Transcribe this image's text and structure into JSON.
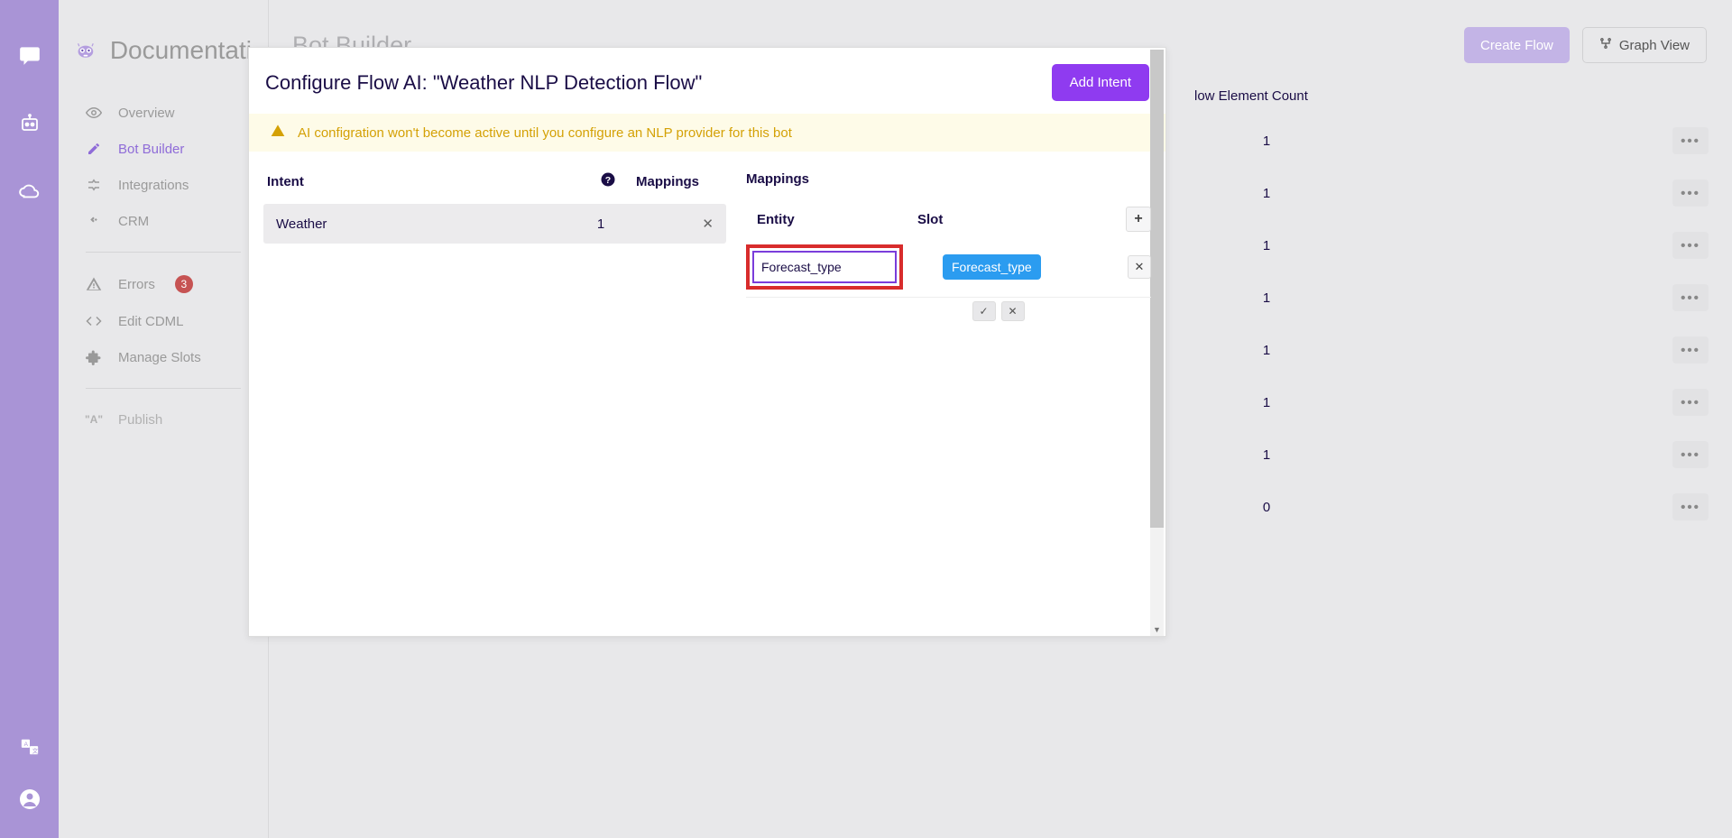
{
  "sidebar": {
    "title": "Documentati",
    "items": [
      {
        "label": "Overview",
        "icon": "eye"
      },
      {
        "label": "Bot Builder",
        "icon": "pencil",
        "active": true
      },
      {
        "label": "Integrations",
        "icon": "integration"
      },
      {
        "label": "CRM",
        "icon": "handshake"
      }
    ],
    "items2": [
      {
        "label": "Errors",
        "icon": "warning",
        "badge": "3"
      },
      {
        "label": "Edit CDML",
        "icon": "code"
      },
      {
        "label": "Manage Slots",
        "icon": "puzzle"
      }
    ],
    "items3": [
      {
        "label": "Publish",
        "icon": "text"
      }
    ]
  },
  "page": {
    "title": "Bot Builder",
    "create_flow": "Create Flow",
    "graph_view": "Graph View",
    "flow_header_count": "low Element Count",
    "flows": [
      {
        "count": "1"
      },
      {
        "count": "1"
      },
      {
        "count": "1"
      },
      {
        "count": "1"
      },
      {
        "count": "1"
      },
      {
        "count": "1"
      },
      {
        "count": "1"
      },
      {
        "count": "0"
      }
    ]
  },
  "modal": {
    "title": "Configure Flow AI: \"Weather NLP Detection Flow\"",
    "add_intent": "Add Intent",
    "alert": "AI configration won't become active until you configure an NLP provider for this bot",
    "intent_header": "Intent",
    "mappings_header": "Mappings",
    "mappings_title": "Mappings",
    "entity_header": "Entity",
    "slot_header": "Slot",
    "intents": [
      {
        "name": "Weather",
        "count": "1"
      }
    ],
    "mapping_entity_value": "Forecast_type",
    "mapping_slot_value": "Forecast_type"
  }
}
